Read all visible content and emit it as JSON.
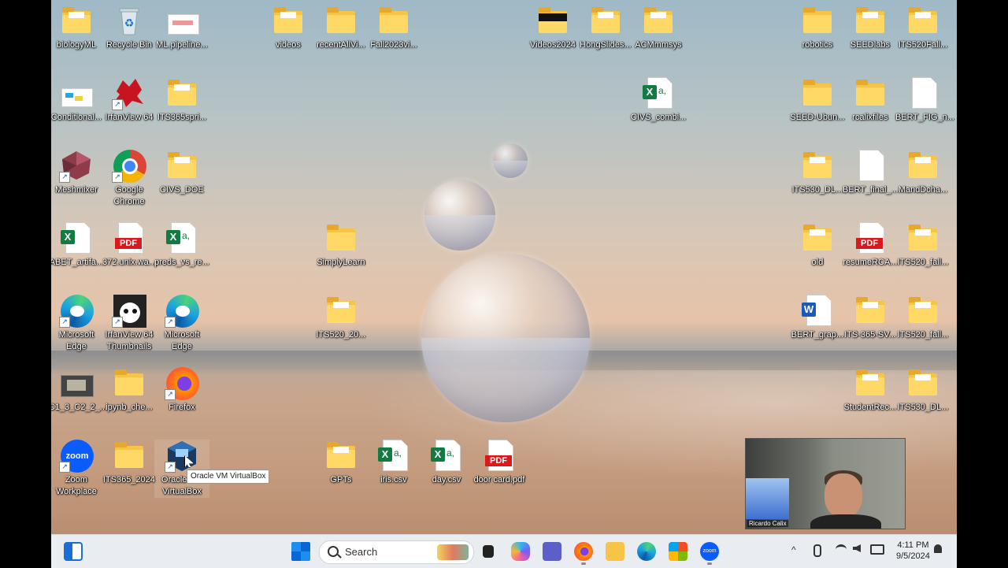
{
  "desktop": {
    "icons": {
      "biologyML": "biologyML",
      "recycle_bin": "Recycle Bin",
      "ml_pipeline": "ML.pipeline...",
      "videos": "videos",
      "recent_all": "recentAllVi...",
      "fall2023": "Fall2023vi...",
      "videos2024": "Videos2024",
      "hong_slides": "HongSlides...",
      "acm_mmsys": "ACMmmsys",
      "robotics": "robotics",
      "seedlabs": "SEEDlabs",
      "its520_fall_top": "ITS520Fall...",
      "conditional": "Conditional...",
      "irfanview64": "IrfanView 64",
      "its365_spri": "ITS365spri...",
      "civs_combi": "CIVS_combi...",
      "seed_ubun": "SEED-Ubun...",
      "rcalixfiles": "rcalixfiles",
      "bert_fig": "BERT_FIG_n...",
      "meshmixer": "Meshmixer",
      "google_chrome": "Google Chrome",
      "civs_doe": "CIVS_DOE",
      "its530_dl_top": "ITS530_DL...",
      "bert_final": "BERT_final_...",
      "mandcha": "MandDcha...",
      "abet": "ABET_artifa...",
      "unix_pdf": "372.unix.wa...",
      "preds_vs": "preds_vs_re...",
      "simplylearn": "SimplyLearn",
      "old": "old",
      "resume_rca": "resumeRCA...",
      "its520_fall_mid": "ITS520_fall...",
      "ms_edge_1": "Microsoft Edge",
      "irfanview_thumbs": "IrfanView 64 Thumbnails",
      "ms_edge_2": "Microsoft Edge",
      "its520_20": "ITS520_20...",
      "bert_grap": "BERT_grap...",
      "its365_sv": "ITS-365-SV...",
      "its520_fall_low": "ITS520_fall...",
      "c1_3_c2": "C1_3_C2_2_...",
      "ipynb_che": "ipynb_che...",
      "firefox": "Firefox",
      "student_rec": "StudentRec...",
      "its530_dl_low": "ITS530_DL...",
      "zoom_workplace": "Zoom Workplace",
      "its365_2024": "ITS365_2024",
      "oracle_vm": "Oracle VM VirtualBox",
      "gpts": "GPTs",
      "iris_csv": "iris.csv",
      "day_csv": "day.csv",
      "door_card": "door card.pdf"
    },
    "tooltip": "Oracle VM VirtualBox",
    "badges": {
      "excel": "X",
      "excel_a": "a,",
      "pdf": "PDF",
      "word": "W",
      "zoom": "zoom"
    }
  },
  "webcam": {
    "name": "Ricardo Calix"
  },
  "taskbar": {
    "search_placeholder": "Search",
    "time": "4:11 PM",
    "date": "9/5/2024",
    "tray_chevron": "^",
    "zoom_text": "zoom"
  },
  "colors": {
    "folder": "#f6c548",
    "excel": "#107c41",
    "pdf": "#d9191c",
    "word": "#185abd",
    "taskbar_bg": "#e9ecf1"
  }
}
